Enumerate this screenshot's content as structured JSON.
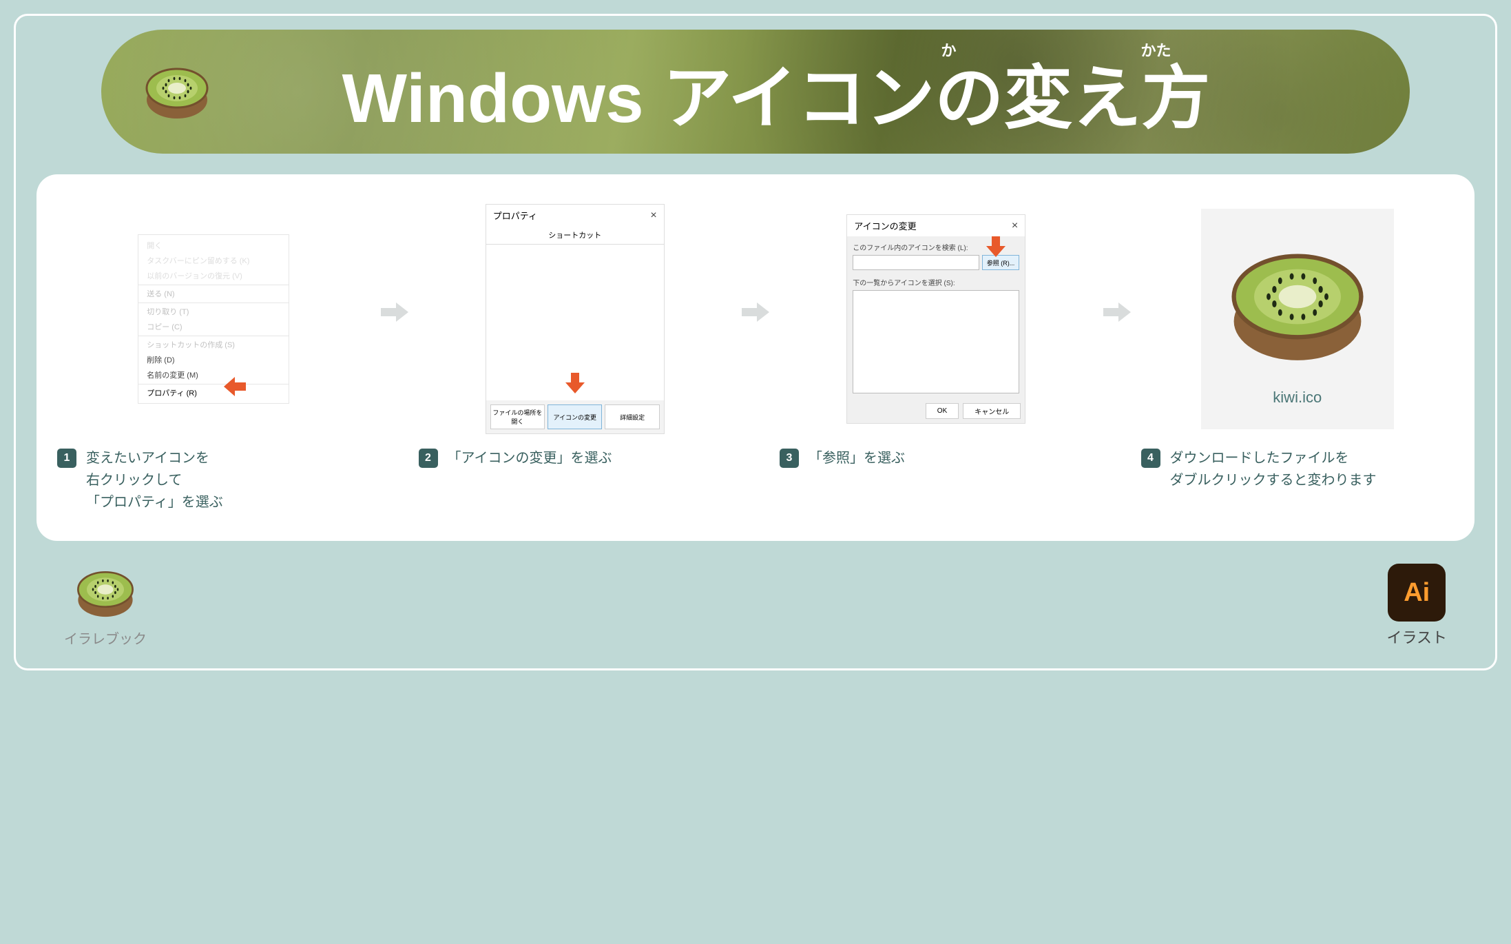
{
  "banner": {
    "title": "Windows アイコンの変え方",
    "ruby1": "か",
    "ruby2": "かた"
  },
  "steps": [
    {
      "num": "1",
      "caption": "変えたいアイコンを\n右クリックして\n「プロパティ」を選ぶ",
      "contextMenu": {
        "items": [
          {
            "label": "開く",
            "style": "faded"
          },
          {
            "label": "タスクバーにピン留めする (K)",
            "style": "faded"
          },
          {
            "label": "以前のバージョンの復元 (V)",
            "style": "faded"
          },
          {
            "label": "送る (N)",
            "style": "light",
            "sep": true
          },
          {
            "label": "切り取り (T)",
            "style": "light",
            "sep": true
          },
          {
            "label": "コピー (C)",
            "style": "light"
          },
          {
            "label": "ショットカットの作成 (S)",
            "style": "light",
            "sep": true
          },
          {
            "label": "削除 (D)",
            "style": "dark"
          },
          {
            "label": "名前の変更 (M)",
            "style": "dark"
          },
          {
            "label": "プロパティ (R)",
            "style": "active",
            "sep": true
          }
        ]
      }
    },
    {
      "num": "2",
      "caption": "「アイコンの変更」を選ぶ",
      "propWin": {
        "title": "プロパティ",
        "tab": "ショートカット",
        "buttons": [
          "ファイルの場所を開く",
          "アイコンの変更",
          "詳細設定"
        ]
      }
    },
    {
      "num": "3",
      "caption": "「参照」を選ぶ",
      "iconWin": {
        "title": "アイコンの変更",
        "label1": "このファイル内のアイコンを検索 (L):",
        "browse": "参照 (R)...",
        "label2": "下の一覧からアイコンを選択 (S):",
        "ok": "OK",
        "cancel": "キャンセル"
      }
    },
    {
      "num": "4",
      "caption": "ダウンロードしたファイルを\nダブルクリックすると変わります",
      "filename": "kiwi.ico"
    }
  ],
  "footer": {
    "left": "イラレブック",
    "rightLabel": "イラスト",
    "aiText": "Ai"
  }
}
